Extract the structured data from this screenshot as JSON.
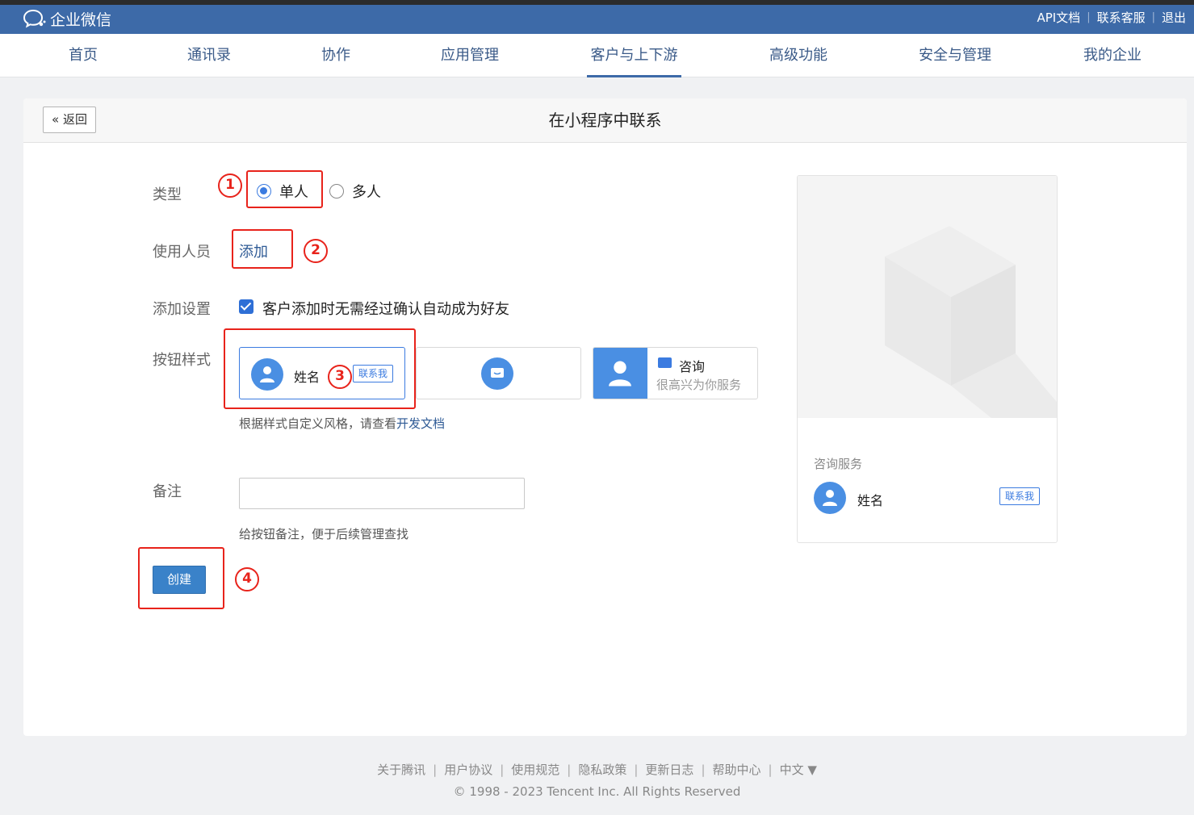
{
  "app": {
    "logo_text": "企业微信",
    "top_links": [
      "API文档",
      "联系客服",
      "退出"
    ]
  },
  "nav": {
    "items": [
      "首页",
      "通讯录",
      "协作",
      "应用管理",
      "客户与上下游",
      "高级功能",
      "安全与管理",
      "我的企业"
    ],
    "active": "客户与上下游"
  },
  "page": {
    "back_label": "返回",
    "title": "在小程序中联系"
  },
  "form": {
    "type_label": "类型",
    "type_options": [
      "单人",
      "多人"
    ],
    "type_selected": "单人",
    "users_label": "使用人员",
    "add_link": "添加",
    "add_setting_label": "添加设置",
    "add_setting_checkbox": "客户添加时无需经过确认自动成为好友",
    "add_setting_checked": true,
    "button_style_label": "按钮样式",
    "style1_name": "姓名",
    "style1_tag": "联系我",
    "style3_title": "咨询",
    "style3_subtitle": "很高兴为你服务",
    "style_hint_prefix": "根据样式自定义风格，请查看",
    "style_hint_link": "开发文档",
    "remark_label": "备注",
    "remark_value": "",
    "remark_hint": "给按钮备注，便于后续管理查找",
    "create_label": "创建"
  },
  "annotations": [
    "1",
    "2",
    "3",
    "4"
  ],
  "preview": {
    "service_title": "咨询服务",
    "name": "姓名",
    "tag": "联系我"
  },
  "footer": {
    "links": [
      "关于腾讯",
      "用户协议",
      "使用规范",
      "隐私政策",
      "更新日志",
      "帮助中心",
      "中文 ▼"
    ],
    "copyright": "© 1998 - 2023 Tencent Inc. All Rights Reserved"
  },
  "colors": {
    "topbar": "#3d6aa8",
    "accent": "#3b7be0",
    "annotation": "#e8231b",
    "button": "#3a82c9"
  }
}
